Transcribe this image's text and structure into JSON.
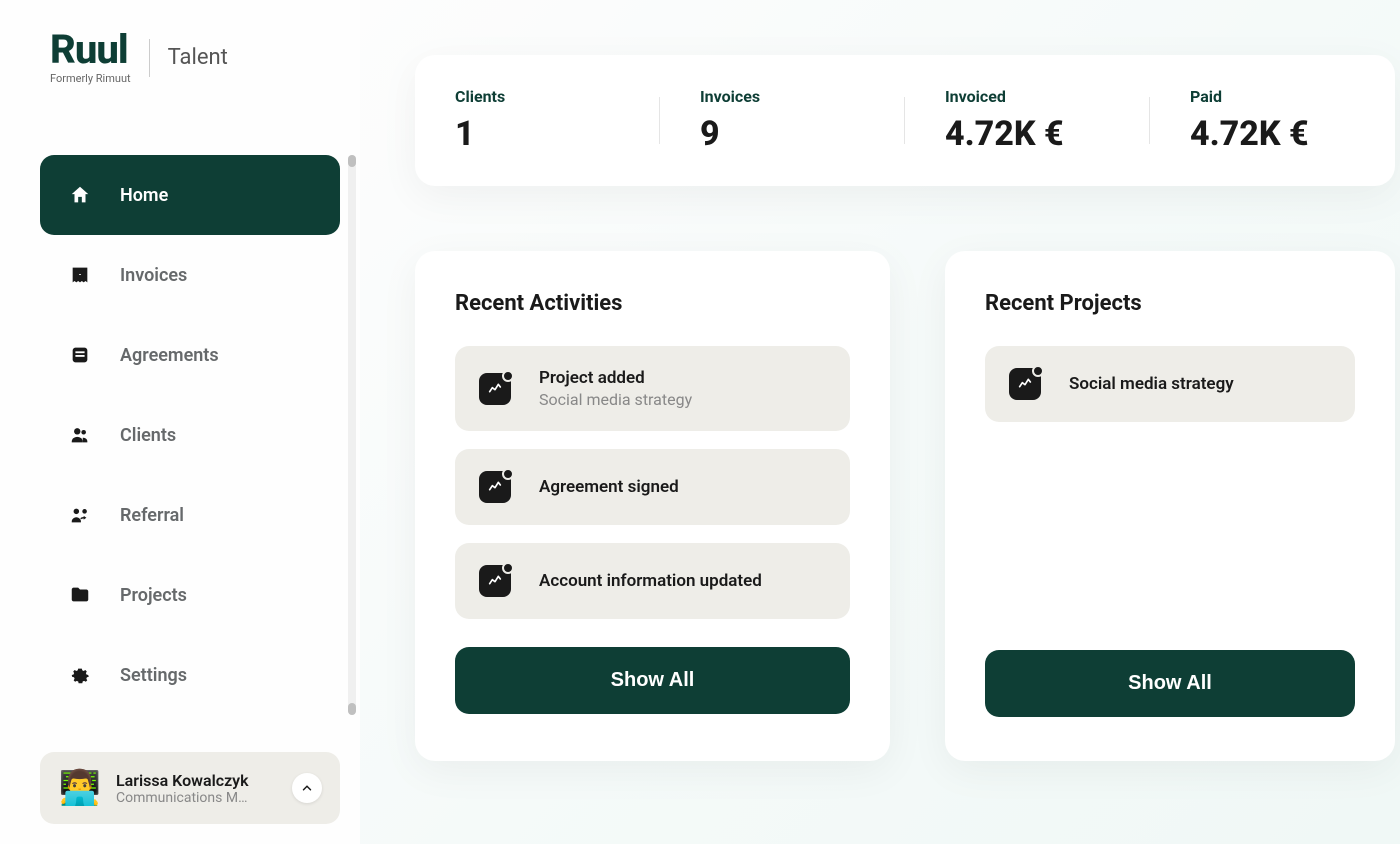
{
  "brand": {
    "name": "Ruul",
    "tagline": "Formerly Rimuut",
    "section": "Talent"
  },
  "sidebar": {
    "items": [
      {
        "label": "Home",
        "icon": "home-icon",
        "active": true
      },
      {
        "label": "Invoices",
        "icon": "invoice-icon",
        "active": false
      },
      {
        "label": "Agreements",
        "icon": "agreements-icon",
        "active": false
      },
      {
        "label": "Clients",
        "icon": "clients-icon",
        "active": false
      },
      {
        "label": "Referral",
        "icon": "referral-icon",
        "active": false
      },
      {
        "label": "Projects",
        "icon": "projects-icon",
        "active": false
      },
      {
        "label": "Settings",
        "icon": "settings-icon",
        "active": false
      }
    ]
  },
  "profile": {
    "name": "Larissa Kowalczyk",
    "role": "Communications M…",
    "avatar_emoji": "👨‍💻"
  },
  "stats": [
    {
      "label": "Clients",
      "value": "1"
    },
    {
      "label": "Invoices",
      "value": "9"
    },
    {
      "label": "Invoiced",
      "value": "4.72K €"
    },
    {
      "label": "Paid",
      "value": "4.72K €"
    }
  ],
  "activities": {
    "title": "Recent Activities",
    "items": [
      {
        "title": "Project added",
        "subtitle": "Social media strategy"
      },
      {
        "title": "Agreement signed",
        "subtitle": ""
      },
      {
        "title": "Account information updated",
        "subtitle": ""
      }
    ],
    "show_all_label": "Show All"
  },
  "projects": {
    "title": "Recent Projects",
    "items": [
      {
        "title": "Social media strategy"
      }
    ],
    "show_all_label": "Show All"
  }
}
